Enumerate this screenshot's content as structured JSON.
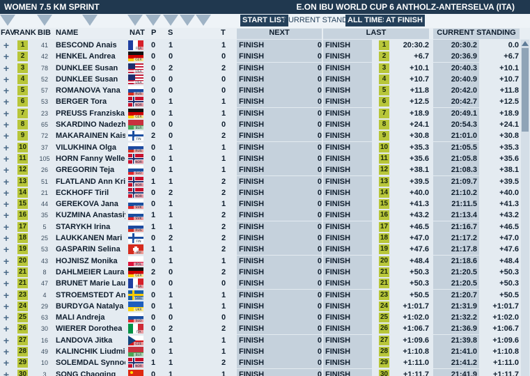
{
  "header": {
    "event_title": "WOMEN 7.5 KM SPRINT",
    "cup_title": "E.ON IBU WORLD CUP 6 ANTHOLZ-ANTERSELVA (ITA)"
  },
  "view_buttons": {
    "start_list": "START LIST",
    "current_standing": "CURRENT STANDING",
    "all_times": "ALL TIMES",
    "at_finish": "AT FINISH"
  },
  "columns": {
    "fav": "FAV",
    "rank": "RANK",
    "bib": "BIB",
    "name": "NAME",
    "nat": "NAT",
    "p": "P",
    "s": "S",
    "t": "T",
    "next": "NEXT",
    "last": "LAST",
    "current_standing": "CURRENT STANDING"
  },
  "colors": {
    "header_bg": "#20384f",
    "rank_badge": "#b8c63a",
    "column_bg": "#c5d1dc"
  },
  "athletes": [
    {
      "rank": "1",
      "bib": "41",
      "name": "BESCOND Anais",
      "nat": "FRA",
      "p": "0",
      "s": "1",
      "t": "1",
      "next": "FINISH",
      "next_val": "0",
      "last": "FINISH",
      "last_rank": "1",
      "last_time": "20:30.2",
      "cur_time": "20:30.2",
      "cur_diff": "0.0"
    },
    {
      "rank": "2",
      "bib": "42",
      "name": "HENKEL Andrea",
      "nat": "GER",
      "p": "0",
      "s": "0",
      "t": "0",
      "next": "FINISH",
      "next_val": "0",
      "last": "FINISH",
      "last_rank": "2",
      "last_time": "+6.7",
      "cur_time": "20:36.9",
      "cur_diff": "+6.7"
    },
    {
      "rank": "3",
      "bib": "78",
      "name": "DUNKLEE Susan",
      "nat": "USA",
      "p": "0",
      "s": "2",
      "t": "2",
      "next": "FINISH",
      "next_val": "0",
      "last": "FINISH",
      "last_rank": "3",
      "last_time": "+10.1",
      "cur_time": "20:40.3",
      "cur_diff": "+10.1"
    },
    {
      "rank": "4",
      "bib": "52",
      "name": "DUNKLEE Susan",
      "nat": "USA",
      "p": "0",
      "s": "0",
      "t": "0",
      "next": "FINISH",
      "next_val": "0",
      "last": "FINISH",
      "last_rank": "4",
      "last_time": "+10.7",
      "cur_time": "20:40.9",
      "cur_diff": "+10.7"
    },
    {
      "rank": "5",
      "bib": "57",
      "name": "ROMANOVA Yana",
      "nat": "RUS",
      "p": "0",
      "s": "0",
      "t": "0",
      "next": "FINISH",
      "next_val": "0",
      "last": "FINISH",
      "last_rank": "5",
      "last_time": "+11.8",
      "cur_time": "20:42.0",
      "cur_diff": "+11.8"
    },
    {
      "rank": "6",
      "bib": "53",
      "name": "BERGER Tora",
      "nat": "NOR",
      "p": "0",
      "s": "1",
      "t": "1",
      "next": "FINISH",
      "next_val": "0",
      "last": "FINISH",
      "last_rank": "6",
      "last_time": "+12.5",
      "cur_time": "20:42.7",
      "cur_diff": "+12.5"
    },
    {
      "rank": "7",
      "bib": "23",
      "name": "PREUSS Franziska",
      "nat": "GER",
      "p": "0",
      "s": "1",
      "t": "1",
      "next": "FINISH",
      "next_val": "0",
      "last": "FINISH",
      "last_rank": "7",
      "last_time": "+18.9",
      "cur_time": "20:49.1",
      "cur_diff": "+18.9"
    },
    {
      "rank": "8",
      "bib": "65",
      "name": "SKARDINO Nadezhda",
      "nat": "BLR",
      "p": "0",
      "s": "0",
      "t": "0",
      "next": "FINISH",
      "next_val": "0",
      "last": "FINISH",
      "last_rank": "8",
      "last_time": "+24.1",
      "cur_time": "20:54.3",
      "cur_diff": "+24.1"
    },
    {
      "rank": "9",
      "bib": "72",
      "name": "MAKARAINEN Kaisa",
      "nat": "FIN",
      "p": "2",
      "s": "0",
      "t": "2",
      "next": "FINISH",
      "next_val": "0",
      "last": "FINISH",
      "last_rank": "9",
      "last_time": "+30.8",
      "cur_time": "21:01.0",
      "cur_diff": "+30.8"
    },
    {
      "rank": "10",
      "bib": "37",
      "name": "VILUKHINA Olga",
      "nat": "RUS",
      "p": "0",
      "s": "1",
      "t": "1",
      "next": "FINISH",
      "next_val": "0",
      "last": "FINISH",
      "last_rank": "10",
      "last_time": "+35.3",
      "cur_time": "21:05.5",
      "cur_diff": "+35.3"
    },
    {
      "rank": "11",
      "bib": "105",
      "name": "HORN Fanny Welle-Strand",
      "nat": "NOR",
      "p": "0",
      "s": "1",
      "t": "1",
      "next": "FINISH",
      "next_val": "0",
      "last": "FINISH",
      "last_rank": "11",
      "last_time": "+35.6",
      "cur_time": "21:05.8",
      "cur_diff": "+35.6"
    },
    {
      "rank": "12",
      "bib": "26",
      "name": "GREGORIN Teja",
      "nat": "SLO",
      "p": "0",
      "s": "1",
      "t": "1",
      "next": "FINISH",
      "next_val": "0",
      "last": "FINISH",
      "last_rank": "12",
      "last_time": "+38.1",
      "cur_time": "21:08.3",
      "cur_diff": "+38.1"
    },
    {
      "rank": "13",
      "bib": "51",
      "name": "FLATLAND Ann Kristin",
      "nat": "NOR",
      "p": "1",
      "s": "1",
      "t": "2",
      "next": "FINISH",
      "next_val": "0",
      "last": "FINISH",
      "last_rank": "13",
      "last_time": "+39.5",
      "cur_time": "21:09.7",
      "cur_diff": "+39.5"
    },
    {
      "rank": "14",
      "bib": "21",
      "name": "ECKHOFF Tiril",
      "nat": "NOR",
      "p": "0",
      "s": "2",
      "t": "2",
      "next": "FINISH",
      "next_val": "0",
      "last": "FINISH",
      "last_rank": "14",
      "last_time": "+40.0",
      "cur_time": "21:10.2",
      "cur_diff": "+40.0"
    },
    {
      "rank": "15",
      "bib": "44",
      "name": "GEREKOVA Jana",
      "nat": "SVK",
      "p": "0",
      "s": "1",
      "t": "1",
      "next": "FINISH",
      "next_val": "0",
      "last": "FINISH",
      "last_rank": "15",
      "last_time": "+41.3",
      "cur_time": "21:11.5",
      "cur_diff": "+41.3"
    },
    {
      "rank": "16",
      "bib": "35",
      "name": "KUZMINA Anastasiya",
      "nat": "SVK",
      "p": "1",
      "s": "1",
      "t": "2",
      "next": "FINISH",
      "next_val": "0",
      "last": "FINISH",
      "last_rank": "16",
      "last_time": "+43.2",
      "cur_time": "21:13.4",
      "cur_diff": "+43.2"
    },
    {
      "rank": "17",
      "bib": "5",
      "name": "STARYKH Irina",
      "nat": "RUS",
      "p": "1",
      "s": "1",
      "t": "2",
      "next": "FINISH",
      "next_val": "0",
      "last": "FINISH",
      "last_rank": "17",
      "last_time": "+46.5",
      "cur_time": "21:16.7",
      "cur_diff": "+46.5"
    },
    {
      "rank": "18",
      "bib": "25",
      "name": "LAUKKANEN Mari",
      "nat": "FIN",
      "p": "0",
      "s": "2",
      "t": "2",
      "next": "FINISH",
      "next_val": "0",
      "last": "FINISH",
      "last_rank": "18",
      "last_time": "+47.0",
      "cur_time": "21:17.2",
      "cur_diff": "+47.0"
    },
    {
      "rank": "19",
      "bib": "53",
      "name": "GASPARIN Selina",
      "nat": "SUI",
      "p": "1",
      "s": "1",
      "t": "2",
      "next": "FINISH",
      "next_val": "0",
      "last": "FINISH",
      "last_rank": "19",
      "last_time": "+47.6",
      "cur_time": "21:17.8",
      "cur_diff": "+47.6"
    },
    {
      "rank": "20",
      "bib": "43",
      "name": "HOJNISZ Monika",
      "nat": "POL",
      "p": "0",
      "s": "1",
      "t": "1",
      "next": "FINISH",
      "next_val": "0",
      "last": "FINISH",
      "last_rank": "20",
      "last_time": "+48.4",
      "cur_time": "21:18.6",
      "cur_diff": "+48.4"
    },
    {
      "rank": "21",
      "bib": "8",
      "name": "DAHLMEIER Laura",
      "nat": "GER",
      "p": "2",
      "s": "0",
      "t": "2",
      "next": "FINISH",
      "next_val": "0",
      "last": "FINISH",
      "last_rank": "21",
      "last_time": "+50.3",
      "cur_time": "21:20.5",
      "cur_diff": "+50.3"
    },
    {
      "rank": "21",
      "bib": "47",
      "name": "BRUNET Marie Laure",
      "nat": "FRA",
      "p": "0",
      "s": "0",
      "t": "0",
      "next": "FINISH",
      "next_val": "0",
      "last": "FINISH",
      "last_rank": "21",
      "last_time": "+50.3",
      "cur_time": "21:20.5",
      "cur_diff": "+50.3"
    },
    {
      "rank": "23",
      "bib": "4",
      "name": "STROEMSTEDT Anna-Karin",
      "nat": "SWE",
      "p": "0",
      "s": "1",
      "t": "1",
      "next": "FINISH",
      "next_val": "0",
      "last": "FINISH",
      "last_rank": "23",
      "last_time": "+50.5",
      "cur_time": "21:20.7",
      "cur_diff": "+50.5"
    },
    {
      "rank": "24",
      "bib": "29",
      "name": "BURDYGA Natalya",
      "nat": "UKR",
      "p": "0",
      "s": "1",
      "t": "1",
      "next": "FINISH",
      "next_val": "0",
      "last": "FINISH",
      "last_rank": "24",
      "last_time": "+1:01.7",
      "cur_time": "21:31.9",
      "cur_diff": "+1:01.7"
    },
    {
      "rank": "25",
      "bib": "63",
      "name": "MALI Andreja",
      "nat": "SLO",
      "p": "0",
      "s": "0",
      "t": "0",
      "next": "FINISH",
      "next_val": "0",
      "last": "FINISH",
      "last_rank": "25",
      "last_time": "+1:02.0",
      "cur_time": "21:32.2",
      "cur_diff": "+1:02.0"
    },
    {
      "rank": "26",
      "bib": "30",
      "name": "WIERER Dorothea",
      "nat": "ITA",
      "p": "0",
      "s": "2",
      "t": "2",
      "next": "FINISH",
      "next_val": "0",
      "last": "FINISH",
      "last_rank": "26",
      "last_time": "+1:06.7",
      "cur_time": "21:36.9",
      "cur_diff": "+1:06.7"
    },
    {
      "rank": "27",
      "bib": "16",
      "name": "LANDOVA Jitka",
      "nat": "CZE",
      "p": "0",
      "s": "1",
      "t": "1",
      "next": "FINISH",
      "next_val": "0",
      "last": "FINISH",
      "last_rank": "27",
      "last_time": "+1:09.6",
      "cur_time": "21:39.8",
      "cur_diff": "+1:09.6"
    },
    {
      "rank": "28",
      "bib": "49",
      "name": "KALINCHIK Liudmila",
      "nat": "BLR",
      "p": "0",
      "s": "1",
      "t": "1",
      "next": "FINISH",
      "next_val": "0",
      "last": "FINISH",
      "last_rank": "28",
      "last_time": "+1:10.8",
      "cur_time": "21:41.0",
      "cur_diff": "+1:10.8"
    },
    {
      "rank": "29",
      "bib": "10",
      "name": "SOLEMDAL Synnoeve",
      "nat": "NOR",
      "p": "1",
      "s": "1",
      "t": "2",
      "next": "FINISH",
      "next_val": "0",
      "last": "FINISH",
      "last_rank": "29",
      "last_time": "+1:11.0",
      "cur_time": "21:41.2",
      "cur_diff": "+1:11.0"
    },
    {
      "rank": "30",
      "bib": "3",
      "name": "SONG Chaoqing",
      "nat": "CHN",
      "p": "0",
      "s": "1",
      "t": "1",
      "next": "FINISH",
      "next_val": "0",
      "last": "FINISH",
      "last_rank": "30",
      "last_time": "+1:11.7",
      "cur_time": "21:41.9",
      "cur_diff": "+1:11.7"
    }
  ]
}
